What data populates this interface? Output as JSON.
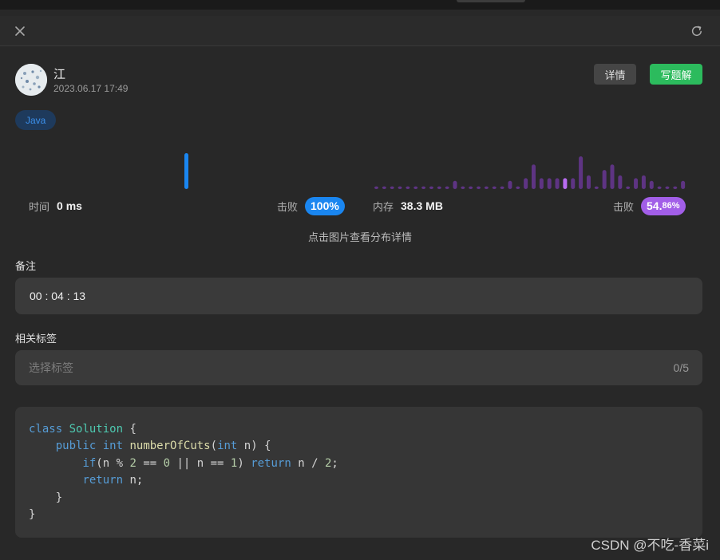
{
  "header": {
    "close_icon": "close-icon",
    "refresh_icon": "refresh-icon"
  },
  "author": {
    "name": "江",
    "datetime": "2023.06.17 17:49",
    "avatar_icon": "avatar"
  },
  "actions": {
    "detail_label": "详情",
    "write_solution_label": "写题解",
    "write_color": "#2cbb5d"
  },
  "language": {
    "label": "Java",
    "color": "#3b8fea"
  },
  "runtime": {
    "label": "时间",
    "value": "0 ms",
    "beat_label": "击败",
    "beat_value": "100%",
    "color": "#1a86f0"
  },
  "memory": {
    "label": "内存",
    "value": "38.3 MB",
    "beat_label": "击败",
    "beat_main": "54.",
    "beat_small": "86%",
    "color": "#a25ee8"
  },
  "chart_data": [
    {
      "type": "bar",
      "name": "runtime-distribution",
      "values": [
        1
      ],
      "highlight_index": 0,
      "color": "#1a86f0"
    },
    {
      "type": "bar",
      "name": "memory-distribution",
      "values": [
        1,
        1,
        1,
        1,
        1,
        1,
        1,
        1,
        1,
        1,
        3,
        1,
        1,
        1,
        1,
        1,
        1,
        3,
        1,
        4,
        9,
        4,
        4,
        4,
        4,
        4,
        12,
        5,
        1,
        7,
        9,
        5,
        1,
        4,
        5,
        3,
        1,
        1,
        1,
        3
      ],
      "highlight_index": 24,
      "color": "#5e3483",
      "highlight_color": "#b86cf0"
    }
  ],
  "chart_hint": "点击图片查看分布详情",
  "notes": {
    "title": "备注",
    "value": "00 : 04 : 13"
  },
  "tags": {
    "title": "相关标签",
    "placeholder": "选择标签",
    "count": "0/5"
  },
  "code": {
    "language": "java",
    "lines": [
      [
        [
          "kw",
          "class"
        ],
        [
          "t",
          " "
        ],
        [
          "cls",
          "Solution"
        ],
        [
          "t",
          " {"
        ]
      ],
      [
        [
          "t",
          "    "
        ],
        [
          "kw",
          "public"
        ],
        [
          "t",
          " "
        ],
        [
          "kw",
          "int"
        ],
        [
          "t",
          " "
        ],
        [
          "fn",
          "numberOfCuts"
        ],
        [
          "t",
          "("
        ],
        [
          "kw",
          "int"
        ],
        [
          "t",
          " n) {"
        ]
      ],
      [
        [
          "t",
          "        "
        ],
        [
          "kw",
          "if"
        ],
        [
          "t",
          "(n % "
        ],
        [
          "num",
          "2"
        ],
        [
          "t",
          " == "
        ],
        [
          "num",
          "0"
        ],
        [
          "t",
          " || n == "
        ],
        [
          "num",
          "1"
        ],
        [
          "t",
          ") "
        ],
        [
          "kw",
          "return"
        ],
        [
          "t",
          " n / "
        ],
        [
          "num",
          "2"
        ],
        [
          "t",
          ";"
        ]
      ],
      [
        [
          "t",
          "        "
        ],
        [
          "kw",
          "return"
        ],
        [
          "t",
          " n;"
        ]
      ],
      [
        [
          "t",
          "    }"
        ]
      ],
      [
        [
          "t",
          "}"
        ]
      ]
    ]
  },
  "watermark": "CSDN @不吃-香菜i"
}
